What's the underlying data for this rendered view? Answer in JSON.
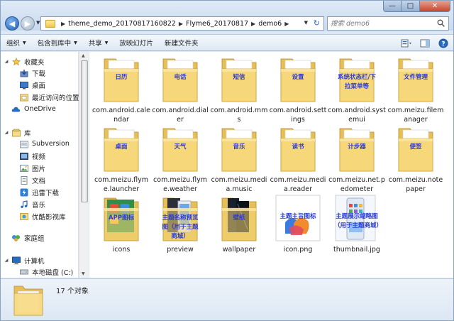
{
  "window": {
    "controls": {
      "minimize": "—",
      "maximize": "□",
      "close": "✕"
    }
  },
  "address": {
    "crumbs": [
      "theme_demo_20170817160822",
      "Flyme6_20170817",
      "demo6"
    ],
    "separator": "▶",
    "dropdown": "▼",
    "refresh": "↻"
  },
  "search": {
    "placeholder": "搜索 demo6"
  },
  "toolbar": {
    "organize": "组织",
    "include_in_library": "包含到库中",
    "share": "共享",
    "slideshow": "放映幻灯片",
    "new_folder": "新建文件夹",
    "dropdown_arrow": "▼"
  },
  "sidebar": {
    "favorites": {
      "label": "收藏夹",
      "items": [
        "下载",
        "桌面",
        "最近访问的位置"
      ]
    },
    "onedrive": "OneDrive",
    "libraries": {
      "label": "库",
      "items": [
        "Subversion",
        "视频",
        "图片",
        "文档",
        "迅雷下载",
        "音乐",
        "优酷影视库"
      ]
    },
    "homegroup": "家庭组",
    "computer": {
      "label": "计算机",
      "items": [
        "本地磁盘 (C:)"
      ]
    }
  },
  "items": [
    {
      "name": "com.android.calendar",
      "label": "日历",
      "type": "folder"
    },
    {
      "name": "com.android.dialer",
      "label": "电话",
      "type": "folder"
    },
    {
      "name": "com.android.mms",
      "label": "短信",
      "type": "folder"
    },
    {
      "name": "com.android.settings",
      "label": "设置",
      "type": "folder"
    },
    {
      "name": "com.android.systemui",
      "label": "系统状态栏/下拉菜单等",
      "type": "folder"
    },
    {
      "name": "com.meizu.filemanager",
      "label": "文件管理",
      "type": "folder"
    },
    {
      "name": "com.meizu.flyme.launcher",
      "label": "桌面",
      "type": "folder"
    },
    {
      "name": "com.meizu.flyme.weather",
      "label": "天气",
      "type": "folder"
    },
    {
      "name": "com.meizu.media.music",
      "label": "音乐",
      "type": "folder"
    },
    {
      "name": "com.meizu.media.reader",
      "label": "读书",
      "type": "folder"
    },
    {
      "name": "com.meizu.net.pedometer",
      "label": "计步器",
      "type": "folder"
    },
    {
      "name": "com.meizu.notepaper",
      "label": "便签",
      "type": "folder"
    },
    {
      "name": "icons",
      "label": "APP图标",
      "type": "folder"
    },
    {
      "name": "preview",
      "label": "主题名称预览图（用于主题商城）",
      "type": "folder"
    },
    {
      "name": "wallpaper",
      "label": "壁纸",
      "type": "folder"
    },
    {
      "name": "icon.png",
      "label": "主题主旨图标",
      "type": "image"
    },
    {
      "name": "thumbnail.jpg",
      "label": "主题展示缩略图（用于主题商城）",
      "type": "image"
    }
  ],
  "details": {
    "count": "17 个对象"
  },
  "colors": {
    "label_blue": "#2b3bd6",
    "folder_yellow": "#f6d77a",
    "selection": "#cce8ff"
  }
}
